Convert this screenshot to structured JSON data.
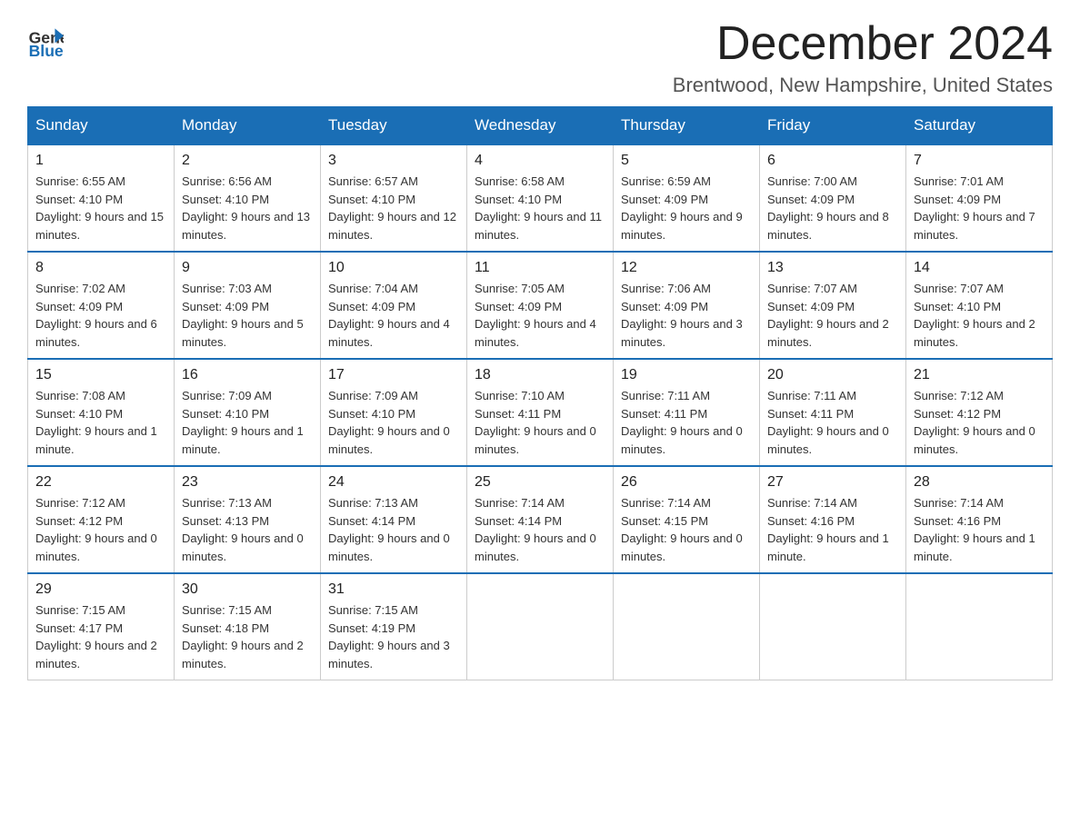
{
  "header": {
    "title": "December 2024",
    "location": "Brentwood, New Hampshire, United States",
    "logo_general": "General",
    "logo_blue": "Blue"
  },
  "calendar": {
    "days_of_week": [
      "Sunday",
      "Monday",
      "Tuesday",
      "Wednesday",
      "Thursday",
      "Friday",
      "Saturday"
    ],
    "weeks": [
      [
        {
          "day": "1",
          "sunrise": "6:55 AM",
          "sunset": "4:10 PM",
          "daylight": "9 hours and 15 minutes."
        },
        {
          "day": "2",
          "sunrise": "6:56 AM",
          "sunset": "4:10 PM",
          "daylight": "9 hours and 13 minutes."
        },
        {
          "day": "3",
          "sunrise": "6:57 AM",
          "sunset": "4:10 PM",
          "daylight": "9 hours and 12 minutes."
        },
        {
          "day": "4",
          "sunrise": "6:58 AM",
          "sunset": "4:10 PM",
          "daylight": "9 hours and 11 minutes."
        },
        {
          "day": "5",
          "sunrise": "6:59 AM",
          "sunset": "4:09 PM",
          "daylight": "9 hours and 9 minutes."
        },
        {
          "day": "6",
          "sunrise": "7:00 AM",
          "sunset": "4:09 PM",
          "daylight": "9 hours and 8 minutes."
        },
        {
          "day": "7",
          "sunrise": "7:01 AM",
          "sunset": "4:09 PM",
          "daylight": "9 hours and 7 minutes."
        }
      ],
      [
        {
          "day": "8",
          "sunrise": "7:02 AM",
          "sunset": "4:09 PM",
          "daylight": "9 hours and 6 minutes."
        },
        {
          "day": "9",
          "sunrise": "7:03 AM",
          "sunset": "4:09 PM",
          "daylight": "9 hours and 5 minutes."
        },
        {
          "day": "10",
          "sunrise": "7:04 AM",
          "sunset": "4:09 PM",
          "daylight": "9 hours and 4 minutes."
        },
        {
          "day": "11",
          "sunrise": "7:05 AM",
          "sunset": "4:09 PM",
          "daylight": "9 hours and 4 minutes."
        },
        {
          "day": "12",
          "sunrise": "7:06 AM",
          "sunset": "4:09 PM",
          "daylight": "9 hours and 3 minutes."
        },
        {
          "day": "13",
          "sunrise": "7:07 AM",
          "sunset": "4:09 PM",
          "daylight": "9 hours and 2 minutes."
        },
        {
          "day": "14",
          "sunrise": "7:07 AM",
          "sunset": "4:10 PM",
          "daylight": "9 hours and 2 minutes."
        }
      ],
      [
        {
          "day": "15",
          "sunrise": "7:08 AM",
          "sunset": "4:10 PM",
          "daylight": "9 hours and 1 minute."
        },
        {
          "day": "16",
          "sunrise": "7:09 AM",
          "sunset": "4:10 PM",
          "daylight": "9 hours and 1 minute."
        },
        {
          "day": "17",
          "sunrise": "7:09 AM",
          "sunset": "4:10 PM",
          "daylight": "9 hours and 0 minutes."
        },
        {
          "day": "18",
          "sunrise": "7:10 AM",
          "sunset": "4:11 PM",
          "daylight": "9 hours and 0 minutes."
        },
        {
          "day": "19",
          "sunrise": "7:11 AM",
          "sunset": "4:11 PM",
          "daylight": "9 hours and 0 minutes."
        },
        {
          "day": "20",
          "sunrise": "7:11 AM",
          "sunset": "4:11 PM",
          "daylight": "9 hours and 0 minutes."
        },
        {
          "day": "21",
          "sunrise": "7:12 AM",
          "sunset": "4:12 PM",
          "daylight": "9 hours and 0 minutes."
        }
      ],
      [
        {
          "day": "22",
          "sunrise": "7:12 AM",
          "sunset": "4:12 PM",
          "daylight": "9 hours and 0 minutes."
        },
        {
          "day": "23",
          "sunrise": "7:13 AM",
          "sunset": "4:13 PM",
          "daylight": "9 hours and 0 minutes."
        },
        {
          "day": "24",
          "sunrise": "7:13 AM",
          "sunset": "4:14 PM",
          "daylight": "9 hours and 0 minutes."
        },
        {
          "day": "25",
          "sunrise": "7:14 AM",
          "sunset": "4:14 PM",
          "daylight": "9 hours and 0 minutes."
        },
        {
          "day": "26",
          "sunrise": "7:14 AM",
          "sunset": "4:15 PM",
          "daylight": "9 hours and 0 minutes."
        },
        {
          "day": "27",
          "sunrise": "7:14 AM",
          "sunset": "4:16 PM",
          "daylight": "9 hours and 1 minute."
        },
        {
          "day": "28",
          "sunrise": "7:14 AM",
          "sunset": "4:16 PM",
          "daylight": "9 hours and 1 minute."
        }
      ],
      [
        {
          "day": "29",
          "sunrise": "7:15 AM",
          "sunset": "4:17 PM",
          "daylight": "9 hours and 2 minutes."
        },
        {
          "day": "30",
          "sunrise": "7:15 AM",
          "sunset": "4:18 PM",
          "daylight": "9 hours and 2 minutes."
        },
        {
          "day": "31",
          "sunrise": "7:15 AM",
          "sunset": "4:19 PM",
          "daylight": "9 hours and 3 minutes."
        },
        null,
        null,
        null,
        null
      ]
    ],
    "labels": {
      "sunrise": "Sunrise:",
      "sunset": "Sunset:",
      "daylight": "Daylight:"
    }
  }
}
